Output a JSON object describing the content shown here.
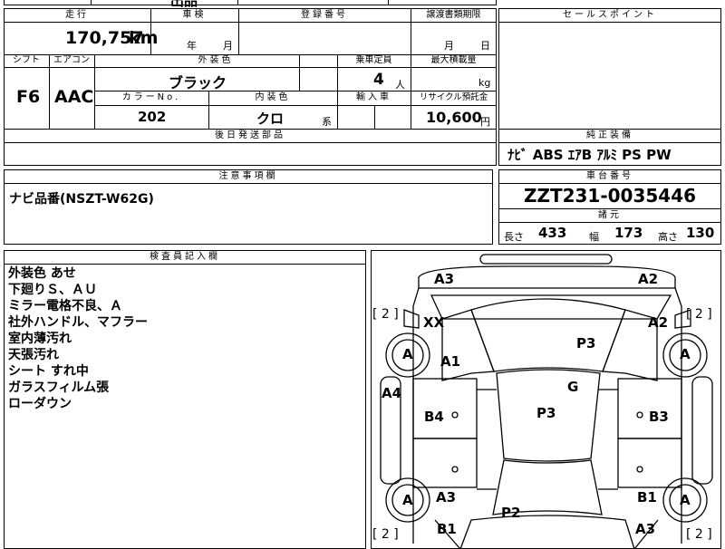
{
  "top": {
    "partial_title": "出品"
  },
  "mileage": {
    "label": "走行",
    "value": "170,757",
    "unit": "km"
  },
  "inspection": {
    "label": "車検",
    "year_unit": "年",
    "month_unit": "月"
  },
  "registration": {
    "label": "登録番号"
  },
  "transfer_deadline": {
    "label": "譲渡書類期限",
    "month_unit": "月",
    "day_unit": "日"
  },
  "sales_points": {
    "label": "セールスポイント"
  },
  "shift": {
    "label": "シフト",
    "value": "F6"
  },
  "aircon": {
    "label": "エアコン",
    "value": "AAC"
  },
  "exterior_color": {
    "label": "外装色",
    "value": "ブラック"
  },
  "capacity": {
    "label": "乗車定員",
    "value": "4",
    "unit": "人"
  },
  "max_load": {
    "label": "最大積載量",
    "unit": "kg"
  },
  "color_no": {
    "label": "カラーNo.",
    "value": "202"
  },
  "interior_color": {
    "label": "内装色",
    "value": "クロ",
    "suffix": "系"
  },
  "import": {
    "label": "輸入車"
  },
  "recycle": {
    "label": "リサイクル預託金",
    "value": "10,600",
    "unit": "円"
  },
  "later_parts": {
    "label": "後日発送部品"
  },
  "genuine_equipment": {
    "label": "純正装備",
    "value": "ﾅﾋﾞ ABS ｴｱB ｱﾙﾐ PS PW"
  },
  "caution": {
    "label": "注意事項欄",
    "text": "ナビ品番(NSZT-W62G)"
  },
  "chassis": {
    "label": "車台番号",
    "value": "ZZT231-0035446"
  },
  "specs": {
    "label": "諸元",
    "length_label": "長さ",
    "length": "433",
    "width_label": "幅",
    "width": "173",
    "height_label": "高さ",
    "height": "130"
  },
  "inspector": {
    "label": "検査員記入欄",
    "lines": [
      "外装色 あせ",
      "下廻りＳ、ＡＵ",
      "ミラー電格不良、Ａ",
      "社外ハンドル、マフラー",
      "室内薄汚れ",
      "天張汚れ",
      "シート すれ中",
      "ガラスフィルム張",
      "ローダウン"
    ]
  },
  "diagram": {
    "marks": {
      "a3_top_left": "A3",
      "a2_top_right": "A2",
      "xx": "XX",
      "a2_right": "A2",
      "p3_upper": "P3",
      "a1": "A1",
      "g": "G",
      "a4": "A4",
      "b4": "B4",
      "p3_center": "P3",
      "b3": "B3",
      "a3_lower_left": "A3",
      "b1_lower_right": "B1",
      "p2": "P2",
      "b1_bottom_left": "B1",
      "a3_bottom_right": "A3",
      "wheel_front_left": "A",
      "wheel_front_right": "A",
      "wheel_rear_left": "A",
      "wheel_rear_right": "A"
    },
    "tire_tags": {
      "front_left": "[ 2 ]",
      "front_right": "[ 2 ]",
      "rear_left": "[ 2 ]",
      "rear_right": "[ 2 ]"
    }
  }
}
